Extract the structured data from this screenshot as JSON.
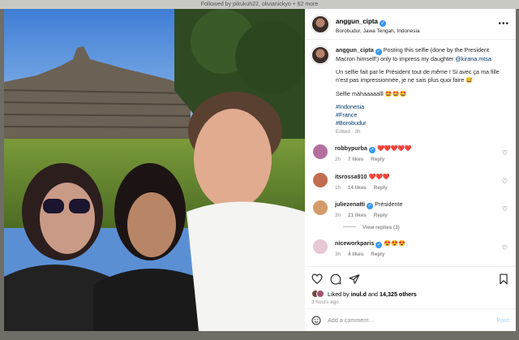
{
  "background": {
    "followed_by": "Followed by pikukuh22, olivianickyo + 62 more"
  },
  "post": {
    "username": "anggun_cipta",
    "location": "Borobudur, Jawa Tengah, Indonesia",
    "more_icon": "more-horizontal-icon",
    "caption": {
      "line1": "Posting this selfie (done by the President Macron himself!) only to impress my daughter",
      "mention": "@kirana.mtsa",
      "line2": "Un selfie fait par le Président tout de même ! Si avec ça ma fille n'est pas impressionnée, je ne sais plus quoi faire 😅",
      "line3": "Selfie mahaaaaalll 🤩🤩🤩",
      "tags": [
        "#Indonesia",
        "#France",
        "#Borobudur"
      ],
      "meta": "Edited · 3h"
    },
    "comments": [
      {
        "user": "robbypurba",
        "text": "❤️❤️❤️❤️❤️",
        "age": "2h",
        "likes": "7 likes",
        "reply": "Reply",
        "avatar": "#b56f9f"
      },
      {
        "user": "itsrossa910",
        "text": "❤️❤️❤️",
        "age": "1h",
        "likes": "14 likes",
        "reply": "Reply",
        "avatar": "#c26d4f"
      },
      {
        "user": "juliezenatti",
        "text": "Présidente",
        "age": "3h",
        "likes": "21 likes",
        "reply": "Reply",
        "avatar": "#d49b6a"
      },
      {
        "user": "niceworkparis",
        "text": "😍😍😍",
        "age": "3h",
        "likes": "4 likes",
        "reply": "Reply",
        "avatar": "#e8c7d7"
      }
    ],
    "view_replies": "View replies (3)",
    "liked_by": {
      "prefix": "Liked by",
      "user": "inul.d",
      "and": "and",
      "others": "14,325 others"
    },
    "time_ago": "3 hours ago",
    "add_comment": {
      "placeholder": "Add a comment…",
      "post": "Post"
    }
  },
  "icons": {
    "like": "heart-icon",
    "comment": "comment-icon",
    "share": "send-icon",
    "save": "bookmark-icon",
    "emoji": "smiley-icon"
  },
  "colors": {
    "link": "#00376b",
    "verified": "#3897f0",
    "muted": "#8e8e8e",
    "post_button": "#b2dffc",
    "like_red": "#ed4956"
  }
}
